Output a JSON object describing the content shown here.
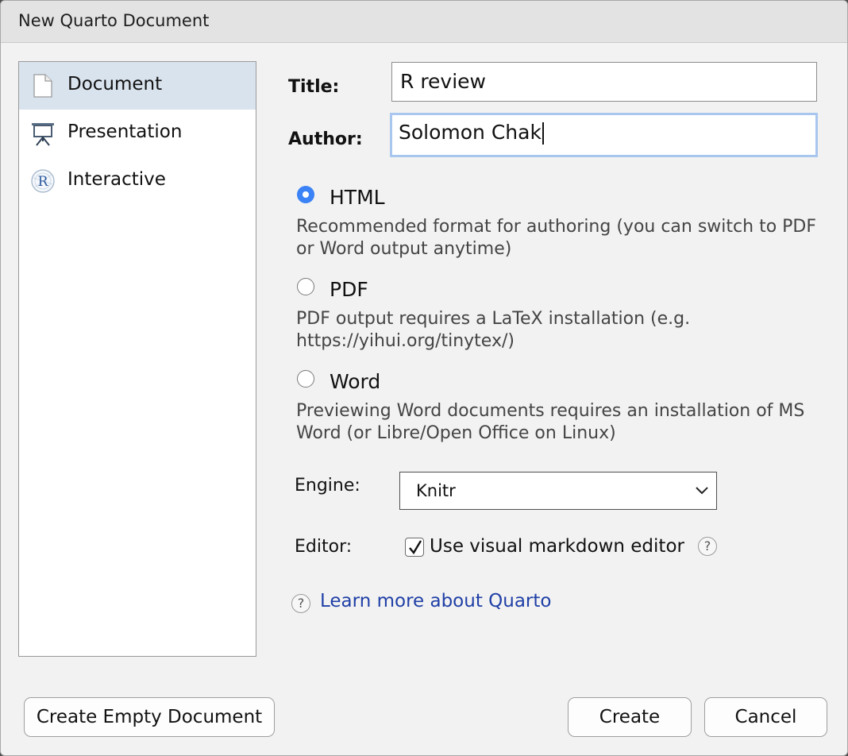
{
  "window": {
    "title": "New Quarto Document"
  },
  "sidebar": {
    "items": [
      {
        "label": "Document",
        "icon": "document-icon",
        "selected": true
      },
      {
        "label": "Presentation",
        "icon": "presentation-easel-icon",
        "selected": false
      },
      {
        "label": "Interactive",
        "icon": "r-logo-icon",
        "selected": false
      }
    ]
  },
  "form": {
    "title_label": "Title:",
    "title_value": "R review",
    "author_label": "Author:",
    "author_value": "Solomon Chak"
  },
  "formats": [
    {
      "label": "HTML",
      "selected": true,
      "description": "Recommended format for authoring (you can switch to PDF or Word output anytime)"
    },
    {
      "label": "PDF",
      "selected": false,
      "description": "PDF output requires a LaTeX installation (e.g. https://yihui.org/tinytex/)"
    },
    {
      "label": "Word",
      "selected": false,
      "description": "Previewing Word documents requires an installation of MS Word (or Libre/Open Office on Linux)"
    }
  ],
  "engine": {
    "label": "Engine:",
    "value": "Knitr"
  },
  "editor": {
    "label": "Editor:",
    "checkbox_label": "Use visual markdown editor",
    "checked": true,
    "help": "?"
  },
  "learn_more": {
    "help": "?",
    "link_text": "Learn more about Quarto"
  },
  "buttons": {
    "create_empty": "Create Empty Document",
    "create": "Create",
    "cancel": "Cancel"
  },
  "colors": {
    "accent": "#3b82f6",
    "selection": "#d9e3ee",
    "link": "#1f3fa6",
    "focus_ring": "#a9c7ee"
  }
}
